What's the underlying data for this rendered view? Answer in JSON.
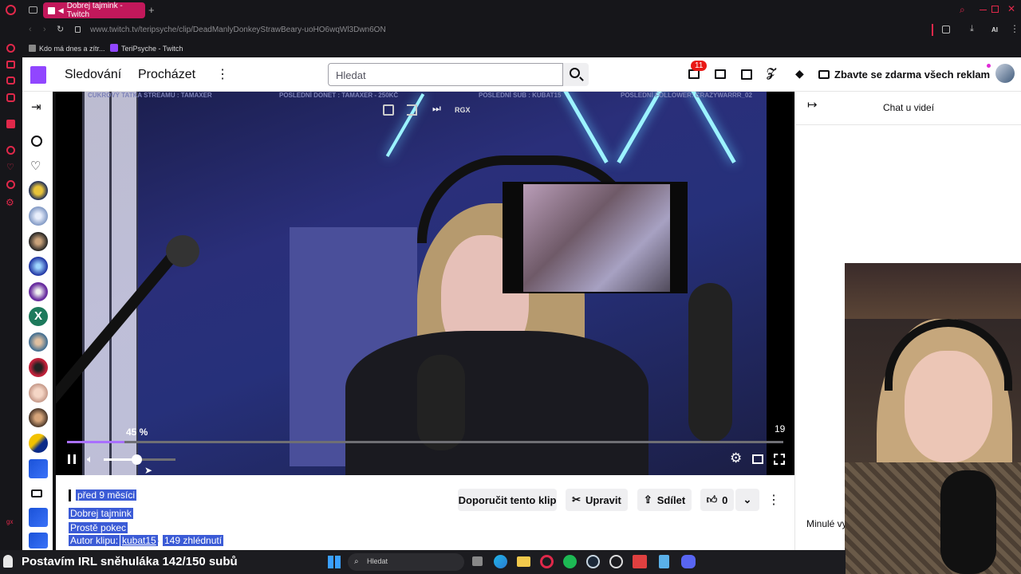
{
  "browser": {
    "tab_title": "Dobrej tajmink - Twitch",
    "url": "www.twitch.tv/teripsyche/clip/DeadManlyDonkeyStrawBeary-uoHO6wqWl3Dwn6ON",
    "bookmarks": [
      "Kdo má dnes a zítr...",
      "TeriPsyche - Twitch"
    ],
    "toolbar_ai": "AI"
  },
  "header": {
    "following": "Sledování",
    "browse": "Procházet",
    "search_placeholder": "Hledat",
    "notification_count": "11",
    "ad_free": "Zbavte se zdarma všech reklam"
  },
  "player": {
    "overlay_top_left": "CUKROVÝ TATKA STREAMU : TAMAXER",
    "overlay_top_mid": "POSLEDNÍ DONET : TAMAXER - 250KČ",
    "overlay_top_mid2": "POSLEDNÍ SUB : KUBAT15",
    "overlay_top_right": "POSLEDNÍ FOLLOWER: CRAZYWARRR_02",
    "rgx": "RGX",
    "volume_label": "45 %",
    "volume_fraction": 0.45,
    "progress_fraction": 0.08,
    "viewers": "19"
  },
  "chat": {
    "title": "Chat u videí",
    "past_text": "Minulé vy"
  },
  "clip": {
    "age": "před 9 měsíci",
    "title": "Dobrej tajmink",
    "category": "Prostě pokec",
    "author_prefix": "Autor klipu:",
    "author": "kubat15",
    "views": "149 zhlédnutí",
    "recommend": "Doporučit tento klip",
    "edit": "Upravit",
    "share": "Sdílet",
    "likes": "0"
  },
  "stream_overlay": {
    "goal": "Postavím IRL sněhuláka 142/150 subů"
  },
  "taskbar": {
    "search": "Hledat"
  },
  "colors": {
    "twitch_purple": "#9146ff",
    "selection_blue": "#3b5bd6",
    "tab_pink": "#c2185b",
    "badge_red": "#e91916"
  }
}
